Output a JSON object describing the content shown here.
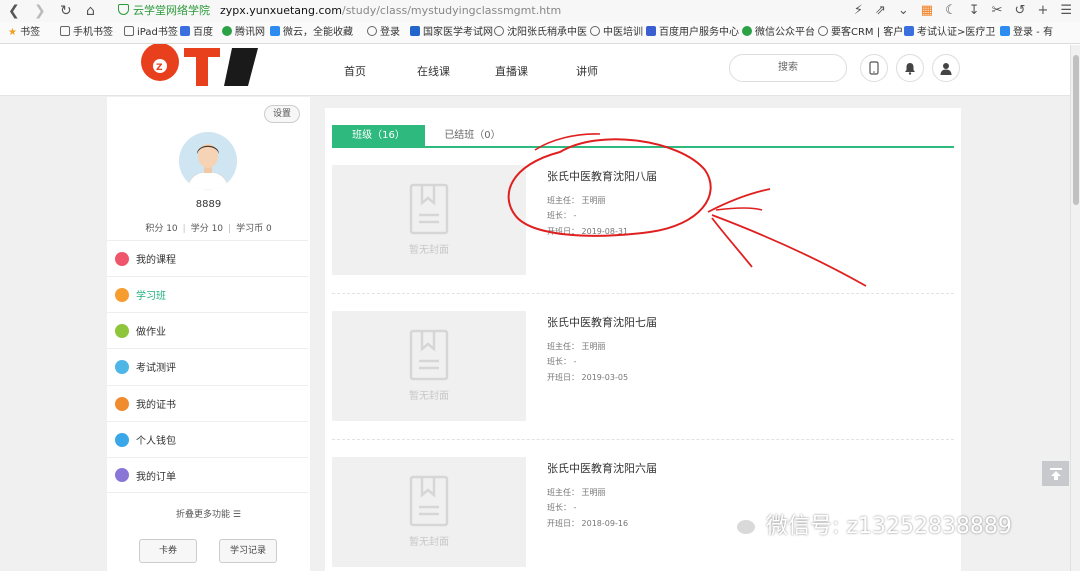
{
  "browser": {
    "site_label": "云学堂网络学院",
    "domain": "zypx.yunxuetang.com",
    "path": "/study/class/mystudyingclassmgmt.htm",
    "bookmarks": [
      "书签",
      "手机书签",
      "iPad书签",
      "百度",
      "腾讯网",
      "微云，全能收藏",
      "登录",
      "国家医学考试网",
      "沈阳张氏稍承中医",
      "中医培训",
      "百度用户服务中心",
      "微信公众平台",
      "要客CRM | 客户",
      "考试认证>医疗卫",
      "登录 - 有"
    ]
  },
  "header": {
    "nav": [
      "首页",
      "在线课",
      "直播课",
      "讲师"
    ],
    "search_label": "搜索",
    "logo_letters": "OT"
  },
  "sidebar": {
    "settings": "设置",
    "username": "8889",
    "stats": [
      "积分 10",
      "学分 10",
      "学习币 0"
    ],
    "menu": [
      {
        "label": "我的课程",
        "color": "#f0566b"
      },
      {
        "label": "学习班",
        "color": "#f79c2e"
      },
      {
        "label": "做作业",
        "color": "#8fc53a"
      },
      {
        "label": "考试测评",
        "color": "#4db6e6"
      },
      {
        "label": "我的证书",
        "color": "#f08c2e"
      },
      {
        "label": "个人钱包",
        "color": "#3aa7e8"
      },
      {
        "label": "我的订单",
        "color": "#8a76d6"
      }
    ],
    "more": "折叠更多功能 ☰",
    "buttons": [
      "卡券",
      "学习记录"
    ]
  },
  "tabs": {
    "active": "班级（16）",
    "inactive": "已结班（0）"
  },
  "cover_placeholder": "暂无封面",
  "classes": [
    {
      "title": "张氏中医教育沈阳八届",
      "teacher": "班主任：  王明丽",
      "monitor": "班长：  -",
      "start": "开班日：  2019-08-31"
    },
    {
      "title": "张氏中医教育沈阳七届",
      "teacher": "班主任：  王明丽",
      "monitor": "班长：  -",
      "start": "开班日：  2019-03-05"
    },
    {
      "title": "张氏中医教育沈阳六届",
      "teacher": "班主任：  王明丽",
      "monitor": "班长：  -",
      "start": "开班日：  2018-09-16"
    }
  ],
  "watermark": "微信号: z13252838889",
  "colors": {
    "accent": "#2eb97e",
    "annotation": "#e02020"
  }
}
